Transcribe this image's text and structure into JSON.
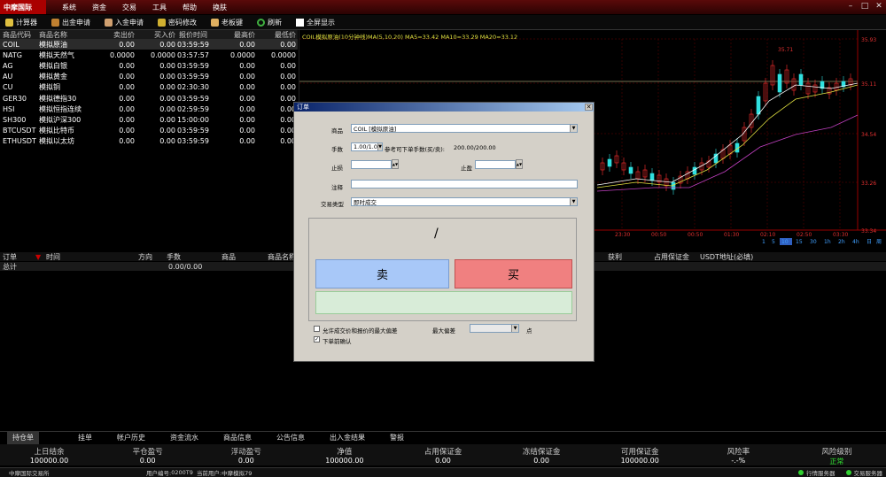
{
  "app": {
    "logo": "中摩国际"
  },
  "menu": [
    "系统",
    "资金",
    "交易",
    "工具",
    "帮助",
    "换肤"
  ],
  "window_controls": [
    "–",
    "□",
    "✕"
  ],
  "toolbar": [
    {
      "label": "计算器",
      "icon": "calculator-icon",
      "color": "#e0c040"
    },
    {
      "label": "出金申请",
      "icon": "money-bag-icon",
      "color": "#c08030"
    },
    {
      "label": "入金申请",
      "icon": "deposit-icon",
      "color": "#d0a070"
    },
    {
      "label": "密码修改",
      "icon": "key-icon",
      "color": "#d0b030"
    },
    {
      "label": "老板键",
      "icon": "hand-icon",
      "color": "#e0b060"
    },
    {
      "label": "刷新",
      "icon": "refresh-icon",
      "color": "#40b040"
    },
    {
      "label": "全屏显示",
      "icon": "fullscreen-icon",
      "color": "#ffffff"
    }
  ],
  "quote_table": {
    "headers": [
      "商品代码",
      "商品名称",
      "卖出价",
      "买入价",
      "报价时间",
      "最高价",
      "最低价"
    ],
    "rows": [
      [
        "COIL",
        "模拟原油",
        "0.00",
        "0.00",
        "03:59:59",
        "0.00",
        "0.00"
      ],
      [
        "NATG",
        "模拟天然气",
        "0.0000",
        "0.0000",
        "03:57:57",
        "0.0000",
        "0.0000"
      ],
      [
        "AG",
        "模拟白银",
        "0.00",
        "0.00",
        "03:59:59",
        "0.00",
        "0.00"
      ],
      [
        "AU",
        "模拟黄金",
        "0.00",
        "0.00",
        "03:59:59",
        "0.00",
        "0.00"
      ],
      [
        "CU",
        "模拟铜",
        "0.00",
        "0.00",
        "02:30:30",
        "0.00",
        "0.00"
      ],
      [
        "GER30",
        "模拟德指30",
        "0.00",
        "0.00",
        "03:59:59",
        "0.00",
        "0.00"
      ],
      [
        "HSI",
        "模拟恒指连续",
        "0.00",
        "0.00",
        "02:59:59",
        "0.00",
        "0.00"
      ],
      [
        "SH300",
        "模拟沪深300",
        "0.00",
        "0.00",
        "15:00:00",
        "0.00",
        "0.00"
      ],
      [
        "BTCUSDT",
        "模拟比特币",
        "0.00",
        "0.00",
        "03:59:59",
        "0.00",
        "0.00"
      ],
      [
        "ETHUSDT",
        "模拟以太坊",
        "0.00",
        "0.00",
        "03:59:59",
        "0.00",
        "0.00"
      ]
    ]
  },
  "chart": {
    "title": "COIL模拟原油(10分钟线)MA(5,10,20) MA5=33.42 MA10=33.29 MA20=33.12",
    "price_ticks": [
      "35.93",
      "35.11",
      "34.54",
      "33.26",
      "33.34"
    ],
    "current_price": "35.11",
    "time_ticks": [
      "23:30",
      "00:50",
      "00:50",
      "01:30",
      "02:10",
      "02:50",
      "03:30"
    ],
    "periods": [
      "1",
      "5",
      "10",
      "15",
      "30",
      "1h",
      "2h",
      "4h",
      "日",
      "周",
      "月"
    ],
    "active_period": "10",
    "annotation_high": "35.71",
    "colors": {
      "ma5": "#ffffff",
      "ma10": "#e0e040",
      "ma20": "#c040c0",
      "up": "#ff3030",
      "down": "#30e0e0"
    }
  },
  "orders": {
    "headers": [
      "订单",
      "时间",
      "方向",
      "手数",
      "商品",
      "商品名称",
      "获利",
      "占用保证金",
      "USDT地址(必填)"
    ],
    "total_label": "总计",
    "total_value": "0.00/0.00"
  },
  "dialog": {
    "title": "订单",
    "product_label": "商品",
    "product_value": "COIL [模拟原油]",
    "lots_label": "手数",
    "lots_value": "1.00/1.0",
    "lots_ref_label": "参考可下单手数(买/卖):",
    "lots_ref_value": "200.00/200.00",
    "stoploss_label": "止损",
    "takeprofit_label": "止盈",
    "note_label": "注释",
    "type_label": "交易类型",
    "type_value": "即时成交",
    "price_display": "/",
    "sell_label": "卖",
    "buy_label": "买",
    "allow_dev_label": "允许成交价和报价的最大偏差",
    "max_dev_label": "最大偏差",
    "points_label": "点",
    "confirm_label": "下单前确认"
  },
  "bottom_tabs": [
    "持仓单",
    "挂单",
    "帐户历史",
    "资金流水",
    "商品信息",
    "公告信息",
    "出入金结果",
    "警报"
  ],
  "summary": [
    {
      "label": "上日结余",
      "value": "100000.00"
    },
    {
      "label": "平仓盈亏",
      "value": "0.00"
    },
    {
      "label": "浮动盈亏",
      "value": "0.00"
    },
    {
      "label": "净值",
      "value": "100000.00"
    },
    {
      "label": "占用保证金",
      "value": "0.00"
    },
    {
      "label": "冻结保证金",
      "value": "0.00"
    },
    {
      "label": "可用保证金",
      "value": "100000.00"
    },
    {
      "label": "风险率",
      "value": "-.-%"
    },
    {
      "label": "风险级别",
      "value": "正常"
    }
  ],
  "statusbar": {
    "exchange": "中摩国际交易所",
    "user_label": "用户编号:",
    "user_id": "0200T9",
    "current_user_label": "当前用户:",
    "current_user": "中摩模拟79",
    "server1": "行情服务器",
    "server2": "交易服务器"
  }
}
